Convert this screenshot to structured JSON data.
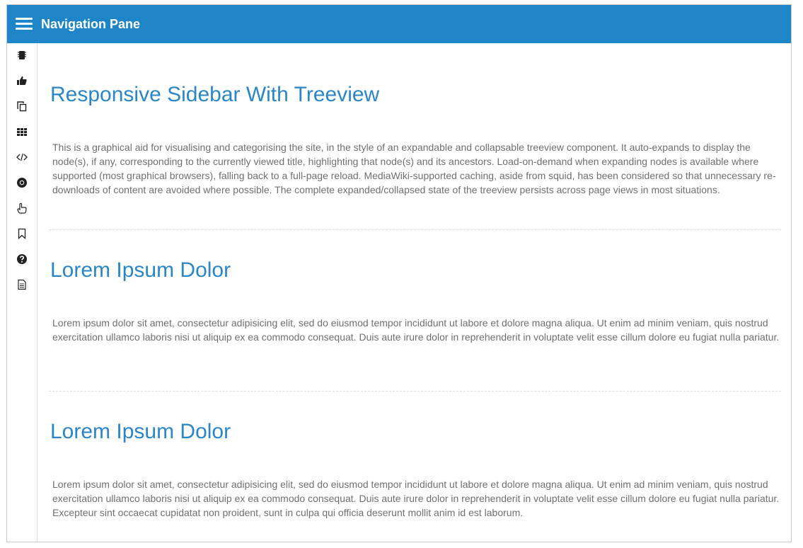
{
  "header": {
    "title": "Navigation Pane"
  },
  "sidebar": {
    "items": [
      {
        "icon": "chip-icon"
      },
      {
        "icon": "thumbs-up-icon"
      },
      {
        "icon": "copy-icon"
      },
      {
        "icon": "grid-icon"
      },
      {
        "icon": "code-icon"
      },
      {
        "icon": "chrome-icon"
      },
      {
        "icon": "hand-point-up-icon"
      },
      {
        "icon": "bookmark-icon"
      },
      {
        "icon": "question-circle-icon"
      },
      {
        "icon": "document-icon"
      }
    ]
  },
  "sections": [
    {
      "heading": "Responsive Sidebar With Treeview",
      "body": "This is a graphical aid for visualising and categorising the site, in the style of an expandable and collapsable treeview component. It auto-expands to display the node(s), if any, corresponding to the currently viewed title, highlighting that node(s) and its ancestors. Load-on-demand when expanding nodes is available where supported (most graphical browsers), falling back to a full-page reload. MediaWiki-supported caching, aside from squid, has been considered so that unnecessary re-downloads of content are avoided where possible. The complete expanded/collapsed state of the treeview persists across page views in most situations."
    },
    {
      "heading": "Lorem Ipsum Dolor",
      "body": "Lorem ipsum dolor sit amet, consectetur adipisicing elit, sed do eiusmod tempor incididunt ut labore et dolore magna aliqua. Ut enim ad minim veniam, quis nostrud exercitation ullamco laboris nisi ut aliquip ex ea commodo consequat. Duis aute irure dolor in reprehenderit in voluptate velit esse cillum dolore eu fugiat nulla pariatur."
    },
    {
      "heading": "Lorem Ipsum Dolor",
      "body": "Lorem ipsum dolor sit amet, consectetur adipisicing elit, sed do eiusmod tempor incididunt ut labore et dolore magna aliqua. Ut enim ad minim veniam, quis nostrud exercitation ullamco laboris nisi ut aliquip ex ea commodo consequat. Duis aute irure dolor in reprehenderit in voluptate velit esse cillum dolore eu fugiat nulla pariatur. Excepteur sint occaecat cupidatat non proident, sunt in culpa qui officia deserunt mollit anim id est laborum."
    }
  ],
  "colors": {
    "header_bg": "#1e86c8",
    "heading": "#2a86c8",
    "body_text": "#6f6f6f"
  }
}
